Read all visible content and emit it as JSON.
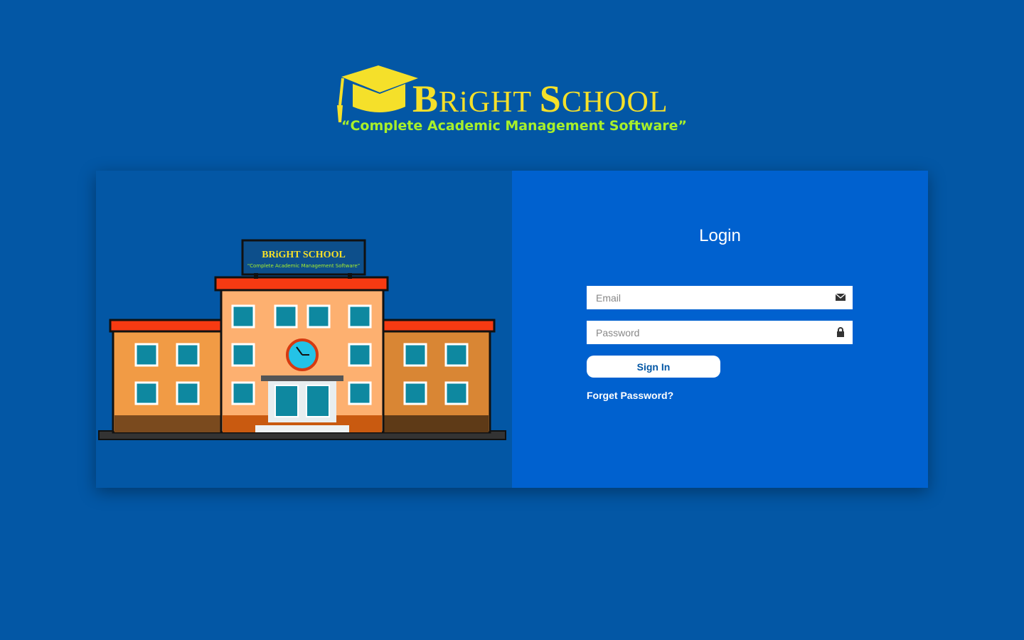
{
  "brand": {
    "title_b": "B",
    "title_rest1": "RiGHT ",
    "title_s": "S",
    "title_rest2": "CHOOL",
    "tagline": "“Complete Academic Management Software”",
    "colors": {
      "title": "#f5e02a",
      "tagline": "#a8f02a"
    }
  },
  "login": {
    "title": "Login",
    "email_placeholder": "Email",
    "password_placeholder": "Password",
    "signin_label": "Sign In",
    "forgot_label": "Forget Password?"
  },
  "icons": {
    "email": "envelope-icon",
    "password": "lock-icon",
    "logo": "graduation-cap-icon"
  },
  "colors": {
    "background": "#0357a5",
    "panel": "#0061cf"
  }
}
